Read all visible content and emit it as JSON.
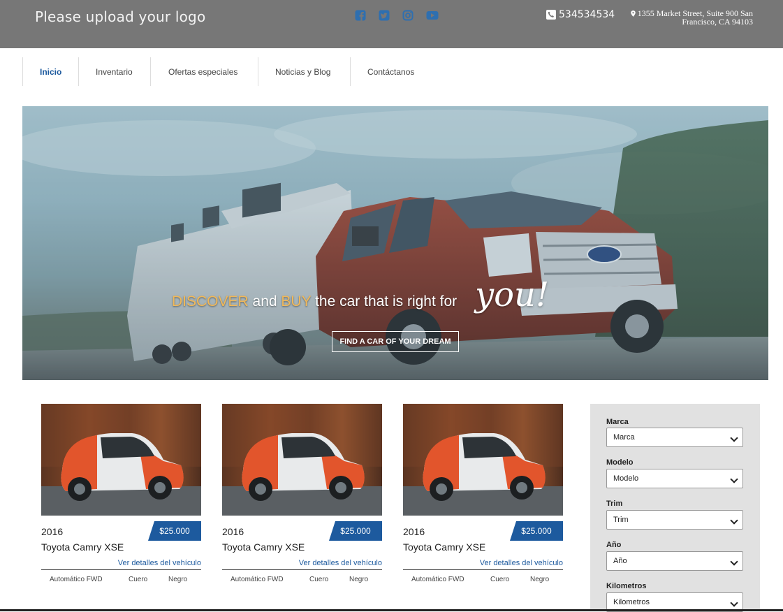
{
  "header": {
    "logo_text": "Please upload your logo",
    "phone": "534534534",
    "address_line1": "1355 Market Street, Suite 900 San",
    "address_line2": "Francisco, CA 94103",
    "social_icons": [
      "facebook-square-icon",
      "twitter-square-icon",
      "instagram-icon",
      "youtube-icon"
    ],
    "social_color": "#2e6fb0"
  },
  "nav": {
    "items": [
      {
        "label": "Inicio",
        "active": true
      },
      {
        "label": "Inventario",
        "active": false
      },
      {
        "label": "Ofertas especiales",
        "active": false
      },
      {
        "label": "Noticias y Blog",
        "active": false
      },
      {
        "label": "Contáctanos",
        "active": false
      }
    ]
  },
  "hero": {
    "word_discover": "DISCOVER",
    "word_and": "and",
    "word_buy": "BUY",
    "rest": "the car that is right for",
    "script": "you!",
    "cta": "FIND A CAR OF YOUR DREAM",
    "accent_color": "#f0b85a"
  },
  "cars": [
    {
      "year": "2016",
      "price": "$25.000",
      "name": "Toyota Camry XSE",
      "link": "Ver detalles del vehículo",
      "transmission": "Automático FWD",
      "interior": "Cuero",
      "color": "Negro"
    },
    {
      "year": "2016",
      "price": "$25.000",
      "name": "Toyota Camry XSE",
      "link": "Ver detalles del vehículo",
      "transmission": "Automático FWD",
      "interior": "Cuero",
      "color": "Negro"
    },
    {
      "year": "2016",
      "price": "$25.000",
      "name": "Toyota Camry XSE",
      "link": "Ver detalles del vehículo",
      "transmission": "Automático FWD",
      "interior": "Cuero",
      "color": "Negro"
    }
  ],
  "filter": {
    "fields": [
      {
        "label": "Marca",
        "value": "Marca"
      },
      {
        "label": "Modelo",
        "value": "Modelo"
      },
      {
        "label": "Trim",
        "value": "Trim"
      },
      {
        "label": "Año",
        "value": "Año"
      },
      {
        "label": "Kilometros",
        "value": "Kilometros"
      }
    ]
  },
  "colors": {
    "brand_blue": "#1d5a9e",
    "header_bg": "#777777",
    "sidebar_bg": "#e1e1e1"
  }
}
